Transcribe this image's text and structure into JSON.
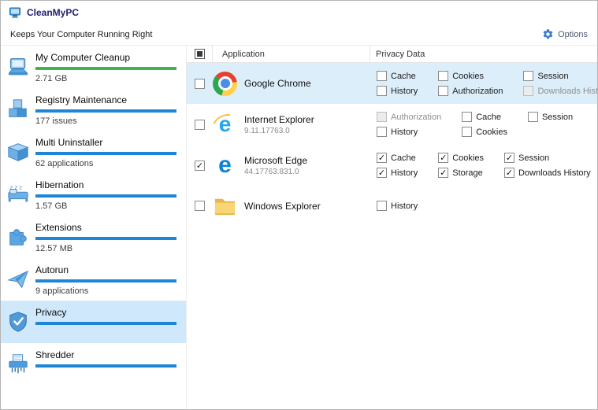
{
  "window": {
    "title": "CleanMyPC",
    "tagline": "Keeps Your Computer Running Right",
    "options_label": "Options"
  },
  "colors": {
    "accent_blue": "#2f7fd0",
    "green_bar": "#3cb54a",
    "blue_bar": "#1e86d7",
    "selected_sidebar": "#cfe8fb",
    "highlight_row": "#ddeefb"
  },
  "sidebar": {
    "items": [
      {
        "label": "My Computer Cleanup",
        "sub": "2.71 GB",
        "bar_color": "#3cb54a",
        "icon": "laptop-icon",
        "selected": false
      },
      {
        "label": "Registry Maintenance",
        "sub": "177 issues",
        "bar_color": "#1e86d7",
        "icon": "cubes-icon",
        "selected": false
      },
      {
        "label": "Multi Uninstaller",
        "sub": "62 applications",
        "bar_color": "#1e86d7",
        "icon": "box-icon",
        "selected": false
      },
      {
        "label": "Hibernation",
        "sub": "1.57 GB",
        "bar_color": "#1e86d7",
        "icon": "hibernation-icon",
        "selected": false
      },
      {
        "label": "Extensions",
        "sub": "12.57 MB",
        "bar_color": "#1e86d7",
        "icon": "puzzle-icon",
        "selected": false
      },
      {
        "label": "Autorun",
        "sub": "9 applications",
        "bar_color": "#1e86d7",
        "icon": "plane-icon",
        "selected": false
      },
      {
        "label": "Privacy",
        "sub": "",
        "bar_color": "#1e86d7",
        "icon": "shield-icon",
        "selected": true
      },
      {
        "label": "Shredder",
        "sub": "",
        "bar_color": "#1e86d7",
        "icon": "shredder-icon",
        "selected": false
      }
    ]
  },
  "table": {
    "columns": {
      "application": "Application",
      "privacy_data": "Privacy Data"
    },
    "header_checkbox_state": "indeterminate",
    "rows": [
      {
        "app": "Google Chrome",
        "version": "",
        "checked": false,
        "highlighted": true,
        "icon": "chrome-icon",
        "options": [
          {
            "label": "Cache",
            "checked": false,
            "disabled": false
          },
          {
            "label": "Cookies",
            "checked": false,
            "disabled": false
          },
          {
            "label": "Session",
            "checked": false,
            "disabled": false
          },
          {
            "label": "History",
            "checked": false,
            "disabled": false
          },
          {
            "label": "Authorization",
            "checked": false,
            "disabled": false
          },
          {
            "label": "Downloads History",
            "checked": false,
            "disabled": true
          }
        ]
      },
      {
        "app": "Internet Explorer",
        "version": "9.11.17763.0",
        "checked": false,
        "highlighted": false,
        "icon": "ie-icon",
        "options": [
          {
            "label": "Authorization",
            "checked": false,
            "disabled": true
          },
          {
            "label": "Cache",
            "checked": false,
            "disabled": false
          },
          {
            "label": "Session",
            "checked": false,
            "disabled": false
          },
          {
            "label": "History",
            "checked": false,
            "disabled": false
          },
          {
            "label": "Cookies",
            "checked": false,
            "disabled": false
          }
        ]
      },
      {
        "app": "Microsoft Edge",
        "version": "44.17763.831.0",
        "checked": true,
        "highlighted": false,
        "icon": "edge-icon",
        "options": [
          {
            "label": "Cache",
            "checked": true,
            "disabled": false
          },
          {
            "label": "Cookies",
            "checked": true,
            "disabled": false
          },
          {
            "label": "Session",
            "checked": true,
            "disabled": false
          },
          {
            "label": "History",
            "checked": true,
            "disabled": false
          },
          {
            "label": "Storage",
            "checked": true,
            "disabled": false
          },
          {
            "label": "Downloads History",
            "checked": true,
            "disabled": false
          }
        ]
      },
      {
        "app": "Windows Explorer",
        "version": "",
        "checked": false,
        "highlighted": false,
        "icon": "folder-icon",
        "options": [
          {
            "label": "History",
            "checked": false,
            "disabled": false
          }
        ]
      }
    ]
  }
}
